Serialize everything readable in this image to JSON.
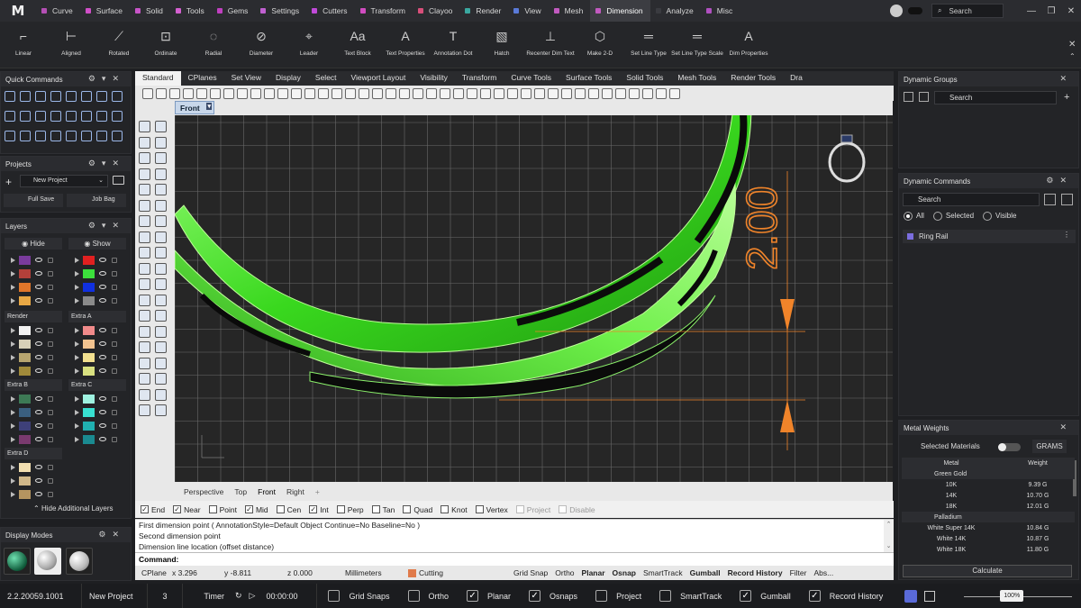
{
  "app": {
    "logo": "M",
    "version": "2.2.20059.1001",
    "project": "New Project",
    "count": "3",
    "timer_label": "Timer",
    "timer_value": "00:00:00",
    "zoom": "100%"
  },
  "menu": {
    "tabs": [
      {
        "label": "Curve",
        "color": "#b44fb4"
      },
      {
        "label": "Surface",
        "color": "#d04fc8"
      },
      {
        "label": "Solid",
        "color": "#c855c8"
      },
      {
        "label": "Tools",
        "color": "#d460d0"
      },
      {
        "label": "Gems",
        "color": "#c040c0"
      },
      {
        "label": "Settings",
        "color": "#c060d0"
      },
      {
        "label": "Cutters",
        "color": "#c04ad8"
      },
      {
        "label": "Transform",
        "color": "#d04cc0"
      },
      {
        "label": "Clayoo",
        "color": "#d84f7a"
      },
      {
        "label": "Render",
        "color": "#3aa8a0"
      },
      {
        "label": "View",
        "color": "#5a7ad8"
      },
      {
        "label": "Mesh",
        "color": "#c25ac0"
      },
      {
        "label": "Dimension",
        "color": "#c25ac0"
      },
      {
        "label": "Analyze",
        "color": "#3a3b40"
      },
      {
        "label": "Misc",
        "color": "#b050c0"
      }
    ],
    "active": "Dimension",
    "search_placeholder": "Search"
  },
  "ribbon": {
    "buttons": [
      {
        "label": "Linear",
        "icon": "linear-dim-icon",
        "glyph": "⌐"
      },
      {
        "label": "Aligned",
        "icon": "aligned-dim-icon",
        "glyph": "⊢"
      },
      {
        "label": "Rotated",
        "icon": "rotated-dim-icon",
        "glyph": "⟋"
      },
      {
        "label": "Ordinate",
        "icon": "ordinate-dim-icon",
        "glyph": "⊡"
      },
      {
        "label": "Radial",
        "icon": "radial-dim-icon",
        "glyph": "◌"
      },
      {
        "label": "Diameter",
        "icon": "diameter-dim-icon",
        "glyph": "⊘"
      },
      {
        "label": "Leader",
        "icon": "leader-icon",
        "glyph": "⌖"
      },
      {
        "label": "Text Block",
        "icon": "text-block-icon",
        "glyph": "Aa"
      },
      {
        "label": "Text Properties",
        "icon": "text-properties-icon",
        "glyph": "A"
      },
      {
        "label": "Annotation Dot",
        "icon": "annotation-dot-icon",
        "glyph": "T"
      },
      {
        "label": "Hatch",
        "icon": "hatch-icon",
        "glyph": "▧"
      },
      {
        "label": "Recenter Dim Text",
        "icon": "recenter-dim-text-icon",
        "glyph": "⊥"
      },
      {
        "label": "Make 2-D",
        "icon": "make-2d-icon",
        "glyph": "⬡"
      },
      {
        "label": "Set Line Type",
        "icon": "set-line-type-icon",
        "glyph": "═"
      },
      {
        "label": "Set Line Type Scale",
        "icon": "set-line-type-scale-icon",
        "glyph": "═"
      },
      {
        "label": "Dim Properties",
        "icon": "dim-properties-icon",
        "glyph": "A"
      }
    ]
  },
  "left": {
    "quick_commands_title": "Quick Commands",
    "projects_title": "Projects",
    "project_select": "New Project",
    "full_save": "Full Save",
    "job_bag": "Job Bag",
    "layers_title": "Layers",
    "hide_label": "Hide",
    "show_label": "Show",
    "layer_groups": [
      "Render",
      "Extra A",
      "Extra B",
      "Extra C",
      "Extra D"
    ],
    "hide_additional": "Hide Additional Layers",
    "display_modes_title": "Display Modes",
    "layer_colors_top_left": [
      "#7a3b9c",
      "#b3403a",
      "#e0762a",
      "#e8a845"
    ],
    "layer_colors_top_right": [
      "#e02020",
      "#3ce03c",
      "#1030e0",
      "#8a8a8a"
    ],
    "layer_colors_render": [
      "#f2f2f2",
      "#d7d0b8",
      "#b7a56f",
      "#a08a3a"
    ],
    "layer_colors_extra_a": [
      "#f08a8a",
      "#f2c390",
      "#f2e08f",
      "#d8e080"
    ],
    "layer_colors_extra_b": [
      "#3d7a55",
      "#3a5f7f",
      "#3e4079",
      "#7a3a6f"
    ],
    "layer_colors_extra_c": [
      "#9ef2e0",
      "#38e0d0",
      "#20b0b0",
      "#1a8a90"
    ],
    "layer_colors_extra_d": [
      "#f2dfb0",
      "#d0b88a",
      "#b59560"
    ]
  },
  "viewport": {
    "tabs": [
      "Standard",
      "CPlanes",
      "Set View",
      "Display",
      "Select",
      "Viewport Layout",
      "Visibility",
      "Transform",
      "Curve Tools",
      "Surface Tools",
      "Solid Tools",
      "Mesh Tools",
      "Render Tools",
      "Dra"
    ],
    "active_tab": "Standard",
    "view_label": "Front",
    "dimension_value": "2.00",
    "view_tabs": [
      "Perspective",
      "Top",
      "Front",
      "Right"
    ],
    "active_view": "Front"
  },
  "osnaps": [
    {
      "label": "End",
      "checked": true
    },
    {
      "label": "Near",
      "checked": true
    },
    {
      "label": "Point",
      "checked": false
    },
    {
      "label": "Mid",
      "checked": true
    },
    {
      "label": "Cen",
      "checked": false
    },
    {
      "label": "Int",
      "checked": true
    },
    {
      "label": "Perp",
      "checked": false
    },
    {
      "label": "Tan",
      "checked": false
    },
    {
      "label": "Quad",
      "checked": false
    },
    {
      "label": "Knot",
      "checked": false
    },
    {
      "label": "Vertex",
      "checked": false
    },
    {
      "label": "Project",
      "checked": false,
      "disabled": true
    },
    {
      "label": "Disable",
      "checked": false,
      "disabled": true
    }
  ],
  "command": {
    "history": [
      "First dimension point ( AnnotationStyle=Default  Object  Continue=No  Baseline=No )",
      "Second dimension point",
      "Dimension line location (offset distance)"
    ],
    "prompt": "Command:"
  },
  "status": {
    "cplane": "CPlane",
    "x": "x 3.296",
    "y": "y -8.811",
    "z": "z 0.000",
    "units": "Millimeters",
    "layer": "Cutting",
    "toggles": [
      "Grid Snap",
      "Ortho",
      "Planar",
      "Osnap",
      "SmartTrack",
      "Gumball",
      "Record History",
      "Filter",
      "Abs..."
    ],
    "bold_toggles": [
      "Planar",
      "Osnap",
      "Gumball",
      "Record History"
    ]
  },
  "right": {
    "dynamic_groups_title": "Dynamic Groups",
    "search": "Search",
    "dynamic_commands_title": "Dynamic Commands",
    "filter_options": [
      "All",
      "Selected",
      "Visible"
    ],
    "selected_filter": "All",
    "command_item": "Ring Rail",
    "metal_weights_title": "Metal Weights",
    "selected_materials": "Selected Materials",
    "unit_button": "GRAMS",
    "table_headers": [
      "Metal",
      "Weight"
    ],
    "groups": [
      {
        "name": "Green Gold",
        "rows": [
          [
            "10K",
            "9.39 G"
          ],
          [
            "14K",
            "10.70 G"
          ],
          [
            "18K",
            "12.01 G"
          ]
        ]
      },
      {
        "name": "Palladium",
        "rows": [
          [
            "White Super 14K",
            "10.84 G"
          ],
          [
            "White 14K",
            "10.87 G"
          ],
          [
            "White 18K",
            "11.80 G"
          ]
        ]
      }
    ],
    "calculate": "Calculate"
  },
  "bottom": {
    "toggles": [
      {
        "label": "Grid Snaps",
        "checked": false
      },
      {
        "label": "Ortho",
        "checked": false
      },
      {
        "label": "Planar",
        "checked": true
      },
      {
        "label": "Osnaps",
        "checked": true
      },
      {
        "label": "Project",
        "checked": false
      },
      {
        "label": "SmartTrack",
        "checked": false
      },
      {
        "label": "Gumball",
        "checked": true
      },
      {
        "label": "Record History",
        "checked": true
      }
    ]
  }
}
